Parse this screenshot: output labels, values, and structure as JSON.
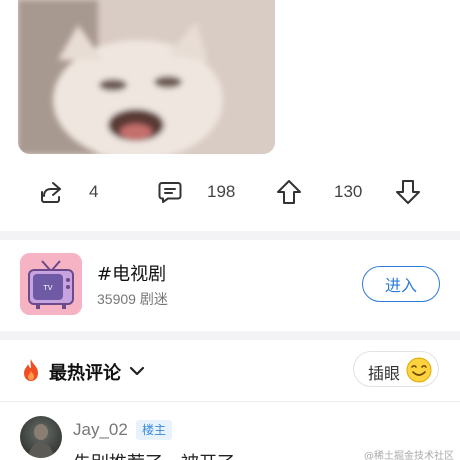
{
  "actions": {
    "share_count": "4",
    "comment_count": "198",
    "upvote_count": "130"
  },
  "topic": {
    "title": "#电视剧",
    "subtitle": "35909 剧迷",
    "enter_label": "进入"
  },
  "comments_header": {
    "label": "最热评论",
    "insert_label": "插眼"
  },
  "comment": {
    "username": "Jay_02",
    "badge": "楼主",
    "text": "先别推荐了，被开了"
  },
  "watermark": "@稀土掘金技术社区",
  "colors": {
    "accent": "#2e7dd7",
    "divider": "#f3f3f6",
    "fire": "#f04e23"
  }
}
